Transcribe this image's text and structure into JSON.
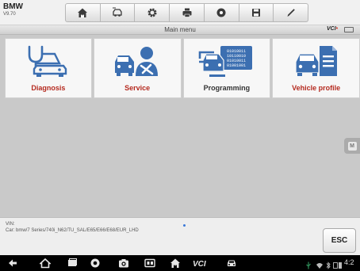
{
  "header": {
    "make": "BMW",
    "version": "V9.70",
    "toolbar_icons": [
      "home-icon",
      "car-swap-icon",
      "gear-icon",
      "printer-icon",
      "help-icon",
      "save-icon",
      "pen-icon"
    ]
  },
  "title_bar": {
    "title": "Main menu",
    "vci_label": "VCI",
    "vci_status_color": "#d23a2a"
  },
  "menu": {
    "tiles": [
      {
        "label": "Diagnosis",
        "icon": "stethoscope-car-icon",
        "label_color": "#b52a1f"
      },
      {
        "label": "Service",
        "icon": "mechanic-car-icon",
        "label_color": "#b52a1f"
      },
      {
        "label": "Programming",
        "icon": "binary-car-icon",
        "label_color": "#333333"
      },
      {
        "label": "Vehicle profile",
        "icon": "car-document-icon",
        "label_color": "#b52a1f"
      }
    ],
    "icon_color": "#3c6fb1"
  },
  "info": {
    "vin_label": "VIN:",
    "car_info": "Car: bmw/7 Series/740i_N62/TU_SAL/E65/E66/E68/EUR_LHD",
    "esc_label": "ESC"
  },
  "android_bar": {
    "buttons": [
      "back-icon",
      "home-icon",
      "recents-icon",
      "browser-icon",
      "camera-icon",
      "screen-mirror-icon",
      "maxisys-home-icon",
      "vci-icon",
      "car-icon"
    ],
    "time": "4:2"
  }
}
